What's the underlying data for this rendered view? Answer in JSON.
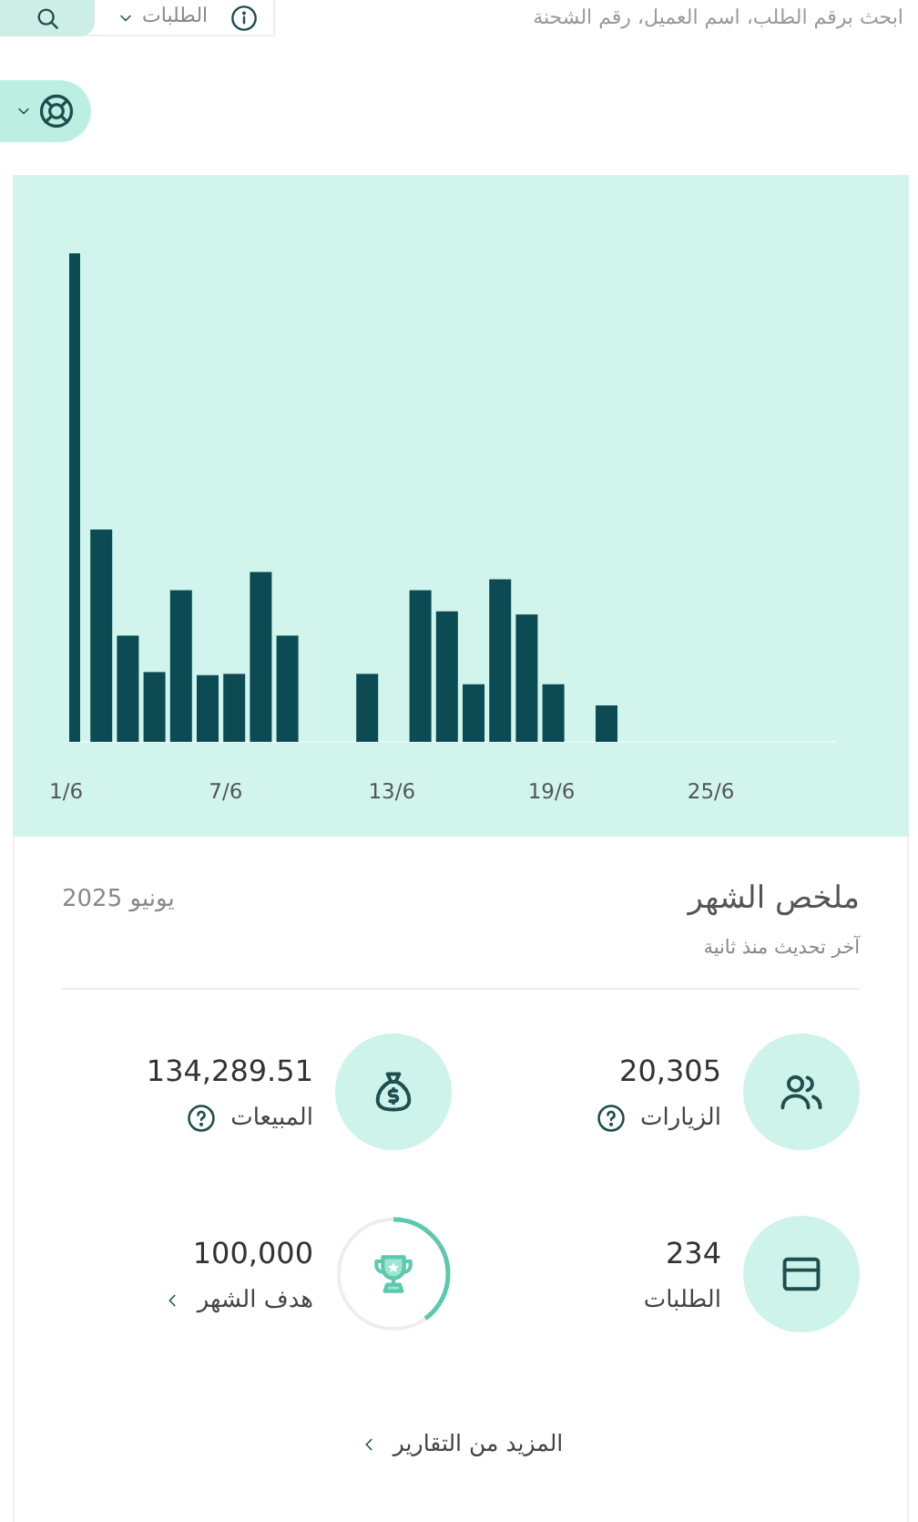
{
  "search": {
    "filter": "الطلبات",
    "placeholder": "ابحث برقم الطلب، اسم العميل، رقم الشحنة"
  },
  "chart": {
    "x_labels": [
      "25/6",
      "19/6",
      "13/6",
      "7/6",
      "1/6"
    ]
  },
  "summary": {
    "title": "ملخص الشهر",
    "period": "يونيو 2025",
    "updated": "آخر تحديث منذ ثانية",
    "stats": [
      {
        "kind": "info",
        "value": "20,305",
        "label": "الزيارات"
      },
      {
        "kind": "info",
        "value": "134,289.51",
        "label": "المبيعات"
      },
      {
        "kind": "plain",
        "value": "234",
        "label": "الطلبات"
      },
      {
        "kind": "goal",
        "value": "100,000",
        "label": "هدف الشهر",
        "level": 0.4
      }
    ],
    "more": "المزيد من التقارير"
  }
}
